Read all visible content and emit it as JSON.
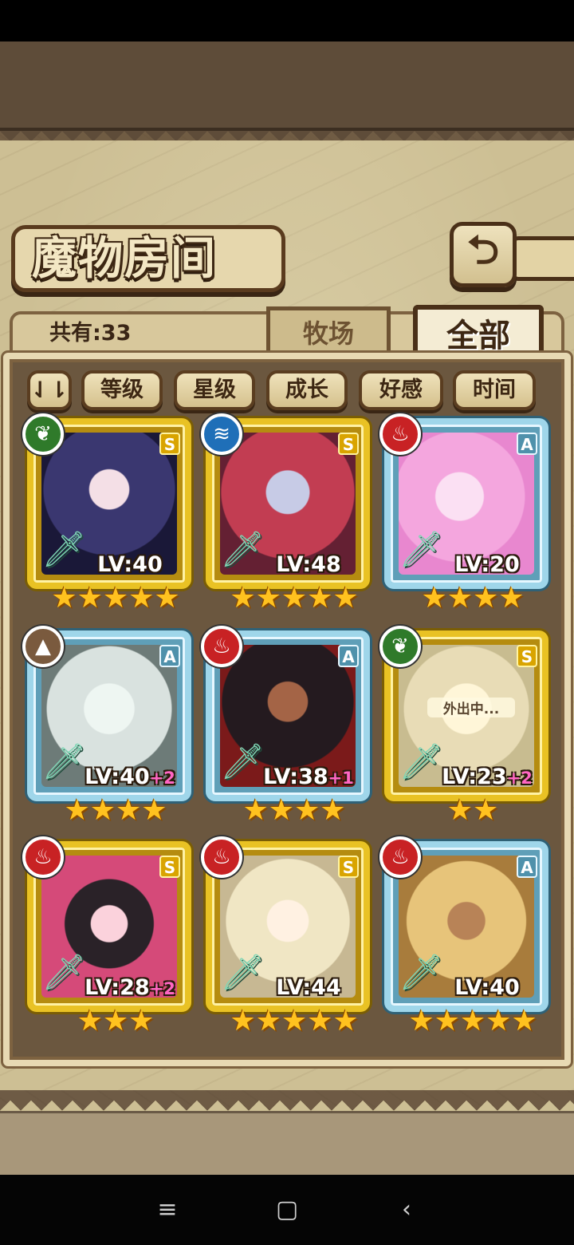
{
  "header": {
    "title": "魔物房间",
    "back_icon": "return-arrow-icon"
  },
  "tabs": {
    "total_count": "共有:33",
    "ranch": "牧场",
    "all": "全部"
  },
  "sort_buttons": {
    "order_toggle": "⇃⇂",
    "level": "等级",
    "stars": "星级",
    "growth": "成长",
    "affection": "好感",
    "time": "时间"
  },
  "cards": [
    {
      "element": "leaf",
      "rank": "S",
      "level": "LV:40",
      "bonus": "",
      "stars": "★★★★★",
      "status": ""
    },
    {
      "element": "water",
      "rank": "S",
      "level": "LV:48",
      "bonus": "",
      "stars": "★★★★★",
      "status": ""
    },
    {
      "element": "fire",
      "rank": "A",
      "level": "LV:20",
      "bonus": "",
      "stars": "★★★★",
      "status": ""
    },
    {
      "element": "earth",
      "rank": "A",
      "level": "LV:40",
      "bonus": "+2",
      "stars": "★★★★",
      "status": ""
    },
    {
      "element": "fire",
      "rank": "A",
      "level": "LV:38",
      "bonus": "+1",
      "stars": "★★★★",
      "status": ""
    },
    {
      "element": "leaf",
      "rank": "S",
      "level": "LV:23",
      "bonus": "+2",
      "stars": "★★",
      "status": "外出中..."
    },
    {
      "element": "fire",
      "rank": "S",
      "level": "LV:28",
      "bonus": "+2",
      "stars": "★★★",
      "status": ""
    },
    {
      "element": "fire",
      "rank": "S",
      "level": "LV:44",
      "bonus": "",
      "stars": "★★★★★",
      "status": ""
    },
    {
      "element": "fire",
      "rank": "A",
      "level": "LV:40",
      "bonus": "",
      "stars": "★★★★★",
      "status": ""
    }
  ],
  "element_icons": {
    "leaf": "leaf-icon",
    "water": "water-wave-icon",
    "fire": "flame-icon",
    "earth": "mountain-icon"
  },
  "nav": {
    "menu": "≡",
    "home": "▢",
    "back": "‹"
  },
  "colors": {
    "rank_S_frame": "#e9c224",
    "rank_A_frame": "#9fd6ea",
    "panel": "#6b573f",
    "parchment": "#cdbf94",
    "bonus_text": "#ff66c4"
  }
}
